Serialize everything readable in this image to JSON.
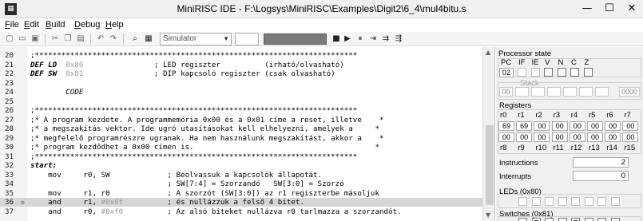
{
  "window": {
    "title": "MiniRISC IDE - F:\\Logsys\\MiniRISC\\Examples\\Digit2\\6_4\\mul4bitu.s",
    "minimize_glyph": "—",
    "maximize_glyph": "☐",
    "close_glyph": "✕"
  },
  "menu": [
    "File",
    "Edit",
    "Build",
    "Debug",
    "Help"
  ],
  "menu_mnemonics": [
    "F",
    "E",
    "B",
    "D",
    "H"
  ],
  "toolbar": {
    "simulator_select": "Simulator"
  },
  "editor": {
    "current_line": 36,
    "lines": [
      {
        "n": "20",
        "segs": [
          {
            "t": ";*************************************************************************",
            "c": ""
          }
        ]
      },
      {
        "n": "21",
        "segs": [
          {
            "t": "DEF LD  ",
            "c": "kw"
          },
          {
            "t": "0x80",
            "c": "dim"
          },
          {
            "t": "                ; LED regiszter          (irható/olvasható)",
            "c": ""
          }
        ]
      },
      {
        "n": "22",
        "segs": [
          {
            "t": "DEF SW  ",
            "c": "kw"
          },
          {
            "t": "0x81",
            "c": "dim"
          },
          {
            "t": "                ; DIP kapcsoló regiszter (csak olvasható)",
            "c": ""
          }
        ]
      },
      {
        "n": "23",
        "segs": [
          {
            "t": "",
            "c": ""
          }
        ]
      },
      {
        "n": "24",
        "segs": [
          {
            "t": "        ",
            "c": ""
          },
          {
            "t": "CODE",
            "c": "italic"
          }
        ]
      },
      {
        "n": "25",
        "segs": [
          {
            "t": "",
            "c": ""
          }
        ]
      },
      {
        "n": "26",
        "segs": [
          {
            "t": ";*************************************************************************",
            "c": ""
          }
        ]
      },
      {
        "n": "27",
        "segs": [
          {
            "t": ";* A program kezdete. A programmemória 0x00 és a 0x01 címe a reset, illetve    *",
            "c": ""
          }
        ]
      },
      {
        "n": "28",
        "segs": [
          {
            "t": ";* a megszakítás vektor. Ide ugró utasításokat kell elhelyezni, amelyek a     *",
            "c": ""
          }
        ]
      },
      {
        "n": "29",
        "segs": [
          {
            "t": ";* megfelelő programrészre ugranak. Ha nem használunk megszakítást, akkor a    *",
            "c": ""
          }
        ]
      },
      {
        "n": "30",
        "segs": [
          {
            "t": ";* program kezdődhet a 0x00 címen is.                                         *",
            "c": ""
          }
        ]
      },
      {
        "n": "31",
        "segs": [
          {
            "t": ";*************************************************************************",
            "c": ""
          }
        ]
      },
      {
        "n": "32",
        "segs": [
          {
            "t": "start:",
            "c": "kw"
          }
        ]
      },
      {
        "n": "33",
        "segs": [
          {
            "t": "    mov     r0, SW             ; Beolvassuk a kapcsolók állapotát.",
            "c": ""
          }
        ]
      },
      {
        "n": "34",
        "segs": [
          {
            "t": "                               ; SW[7:4] = Szorzandó   SW[3:0] = Szorzó",
            "c": ""
          }
        ]
      },
      {
        "n": "35",
        "segs": [
          {
            "t": "    mov     r1, r0             ; A szorzót (SW[3:0]) az r1 regiszterbe másoljuk",
            "c": ""
          }
        ]
      },
      {
        "n": "36",
        "segs": [
          {
            "t": "    and     r1, ",
            "c": ""
          },
          {
            "t": "#0x0f",
            "c": "dim"
          },
          {
            "t": "          ; és nullázzuk a felső 4 bitet.",
            "c": ""
          }
        ]
      },
      {
        "n": "37",
        "segs": [
          {
            "t": "    and     r0, ",
            "c": ""
          },
          {
            "t": "#0xf0",
            "c": "dim"
          },
          {
            "t": "          ; Az alsó biteket nullázva r0 tarlmazza a szorzandót.",
            "c": ""
          }
        ]
      }
    ]
  },
  "processor_state": {
    "title": "Processor state",
    "pc_label": "PC",
    "pc_value": "02",
    "flags": [
      "IF",
      "IE",
      "V",
      "N",
      "C",
      "Z"
    ],
    "stack_label": "Stack",
    "stack_values": [
      "00",
      "",
      "",
      "",
      "",
      "",
      "",
      "0000"
    ],
    "registers_label": "Registers",
    "reg_names_top": [
      "r0",
      "r1",
      "r2",
      "r3",
      "r4",
      "r5",
      "r6",
      "r7"
    ],
    "reg_values_top": [
      "69",
      "69",
      "00",
      "00",
      "00",
      "00",
      "00",
      "00"
    ],
    "reg_values_bottom": [
      "00",
      "00",
      "00",
      "00",
      "00",
      "00",
      "00",
      "00"
    ],
    "reg_names_bottom": [
      "r8",
      "r9",
      "r10",
      "r11",
      "r12",
      "r13",
      "r14",
      "r15"
    ],
    "instructions_label": "Instructions",
    "instructions_value": "2",
    "interrupts_label": "Interrupts",
    "interrupts_value": "0",
    "leds_label": "LEDs (0x80)",
    "switches_label": "Switches (0x81)"
  },
  "icons": [
    "app-icon",
    "new-file-icon",
    "open-folder-icon",
    "save-icon",
    "cut-icon",
    "copy-icon",
    "paste-icon",
    "undo-icon",
    "redo-icon",
    "find-icon",
    "compile-icon",
    "stop-icon",
    "run-icon",
    "pause-icon",
    "step-icon",
    "step-over-icon",
    "run-to-icon",
    "current-line-marker-icon"
  ]
}
